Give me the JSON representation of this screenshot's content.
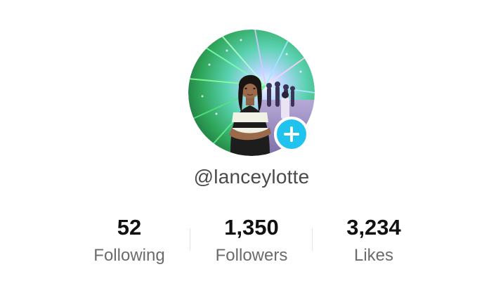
{
  "profile": {
    "username": "@lanceylotte",
    "avatar_alt": "",
    "add_icon": "plus-icon",
    "accent_color": "#20c3ee"
  },
  "stats": [
    {
      "value": "52",
      "label": "Following"
    },
    {
      "value": "1,350",
      "label": "Followers"
    },
    {
      "value": "3,234",
      "label": "Likes"
    }
  ]
}
